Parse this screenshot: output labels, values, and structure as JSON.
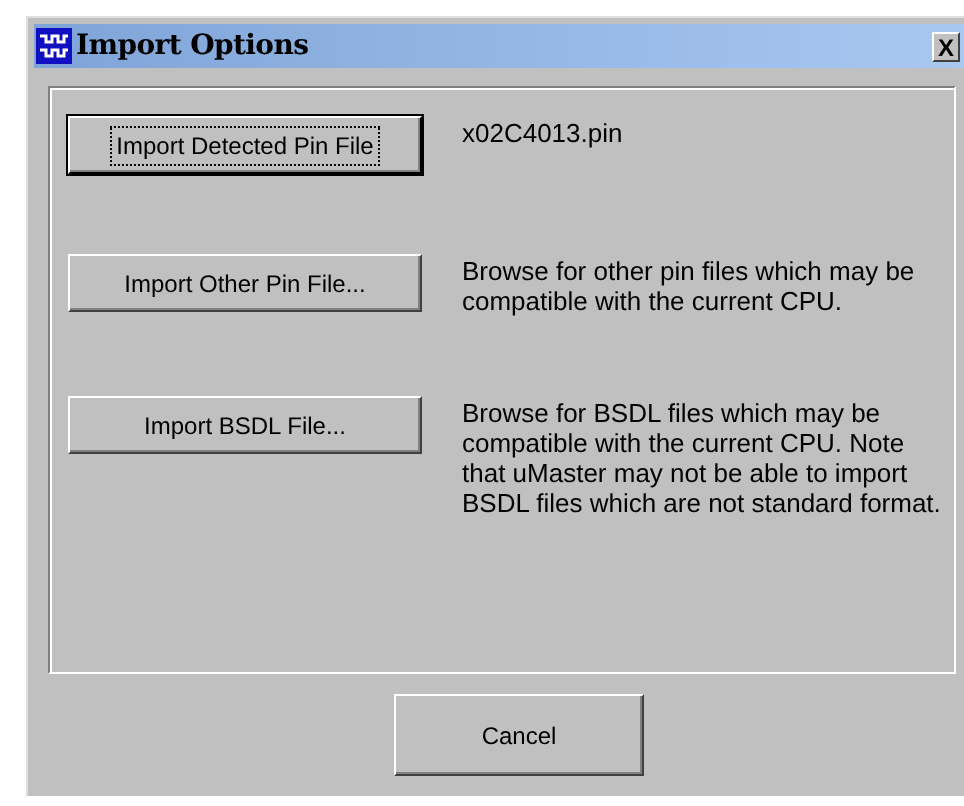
{
  "window": {
    "title": "Import Options",
    "close_button": "X"
  },
  "options": [
    {
      "button": "Import Detected Pin File",
      "focused": true,
      "description": "x02C4013.pin"
    },
    {
      "button": "Import Other Pin File...",
      "focused": false,
      "description": "Browse for other pin files which may be compatible with the current CPU."
    },
    {
      "button": "Import BSDL File...",
      "focused": false,
      "description": "Browse for BSDL files which may be compatible with the current CPU. Note that uMaster may not be able to import BSDL files which are not standard format."
    }
  ],
  "buttons": [
    {
      "label": "Cancel",
      "focused": false
    }
  ]
}
